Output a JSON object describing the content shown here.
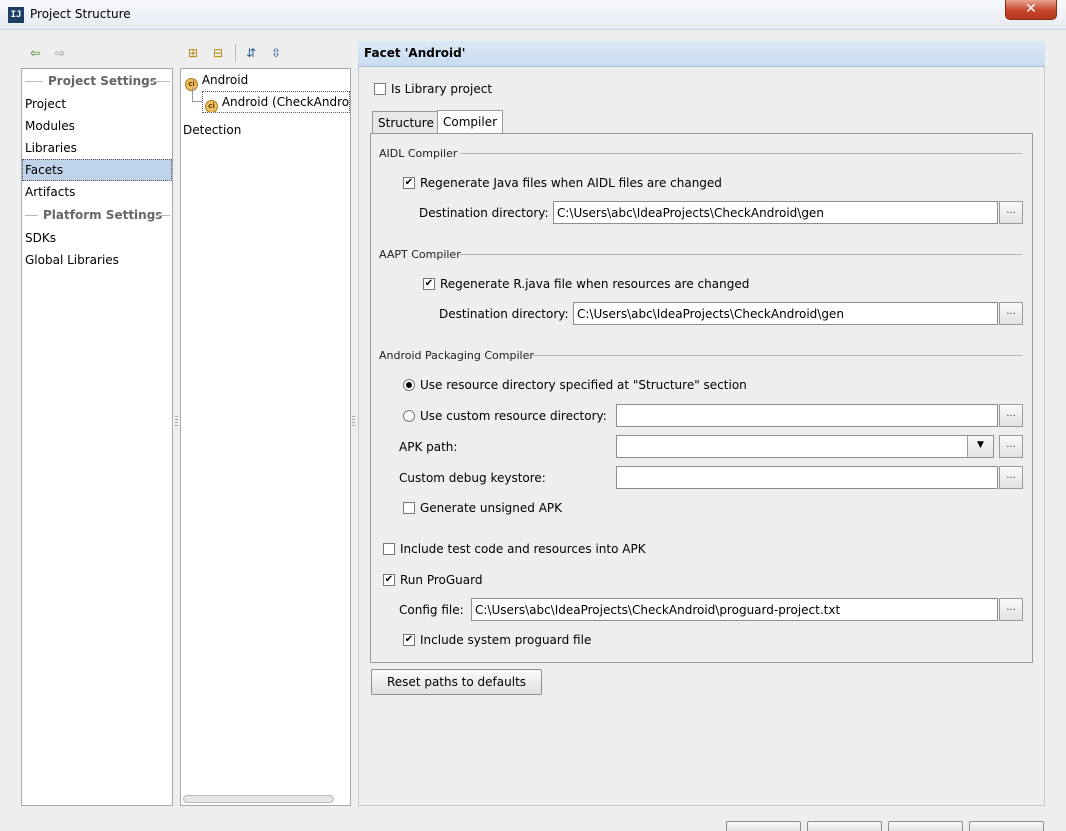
{
  "window": {
    "title": "Project Structure",
    "icon": "intellij-icon",
    "icon_glyph": "IJ",
    "close_glyph": "✕"
  },
  "toolbar_left": {
    "icons": [
      "back-arrow-icon",
      "forward-arrow-icon"
    ],
    "back_glyph": "⇦",
    "forward_glyph": "⇨"
  },
  "toolbar_middle": {
    "icons": [
      "add-icon",
      "remove-icon",
      "expand-all-icon",
      "collapse-all-icon"
    ],
    "add_glyph": "⊞",
    "remove_glyph": "⊟",
    "expand_glyph": "⇵",
    "collapse_glyph": "⇳"
  },
  "sidebar": {
    "project_settings_header": "Project Settings",
    "project_items": [
      "Project",
      "Modules",
      "Libraries",
      "Facets",
      "Artifacts"
    ],
    "platform_settings_header": "Platform Settings",
    "platform_items": [
      "SDKs",
      "Global Libraries"
    ],
    "selected": "Facets"
  },
  "facet_tree": {
    "root_label": "Android",
    "child_label": "Android (CheckAndroi",
    "detection_label": "Detection",
    "facet_icon_glyph": "ci"
  },
  "detail": {
    "header": "Facet 'Android'",
    "is_library_label": "Is Library project",
    "is_library_checked": false,
    "tabs": [
      "Structure",
      "Compiler"
    ],
    "active_tab": "Compiler"
  },
  "aidl": {
    "title": "AIDL Compiler",
    "regenerate_label": "Regenerate Java files when AIDL files are changed",
    "regenerate_checked": true,
    "dest_label": "Destination directory:",
    "dest_value": "C:\\Users\\abc\\IdeaProjects\\CheckAndroid\\gen"
  },
  "aapt": {
    "title": "AAPT Compiler",
    "regenerate_label": "Regenerate R.java file when resources are changed",
    "regenerate_checked": true,
    "dest_label": "Destination directory:",
    "dest_value": "C:\\Users\\abc\\IdeaProjects\\CheckAndroid\\gen"
  },
  "packaging": {
    "title": "Android Packaging Compiler",
    "use_resource_label": "Use resource directory specified at \"Structure\" section",
    "use_custom_label": "Use custom resource directory:",
    "selected_option": "use_resource",
    "custom_dir_value": "",
    "apk_path_label": "APK path:",
    "apk_path_value": "",
    "debug_keystore_label": "Custom debug keystore:",
    "debug_keystore_value": "",
    "unsigned_label": "Generate unsigned APK",
    "unsigned_checked": false
  },
  "options": {
    "include_test_label": "Include test code and resources into APK",
    "include_test_checked": false,
    "run_proguard_label": "Run ProGuard",
    "run_proguard_checked": true,
    "config_file_label": "Config file:",
    "config_file_value": "C:\\Users\\abc\\IdeaProjects\\CheckAndroid\\proguard-project.txt",
    "include_system_label": "Include system proguard file",
    "include_system_checked": true
  },
  "buttons": {
    "reset_paths": "Reset paths to defaults",
    "browse": "..."
  },
  "glyphs": {
    "check": "✔",
    "dropdown": "▼"
  }
}
